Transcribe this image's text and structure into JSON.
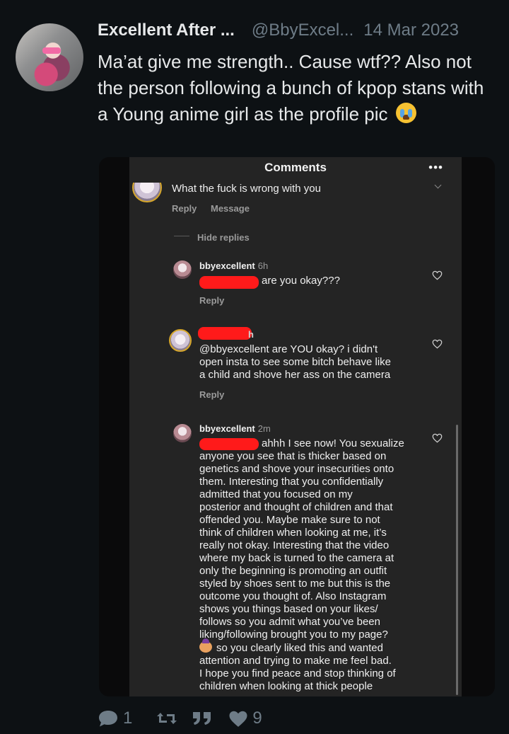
{
  "tweet": {
    "display_name": "Excellent After ...",
    "handle": "@BbyExcel...",
    "date": "14 Mar 2023",
    "text": "Ma’at give me strength.. Cause wtf?? Also not the person following a bunch of kpop stans with a Young anime girl as the profile pic",
    "emoji_icon": "loudly-crying-face"
  },
  "screenshot": {
    "title": "Comments",
    "more_glyph": "•••",
    "top_comment": {
      "text": "What the fuck is wrong with you",
      "reply_label": "Reply",
      "message_label": "Message"
    },
    "hide_replies_label": "Hide replies",
    "replies": [
      {
        "username": "bbyexcellent",
        "time": "6h",
        "text": "are you okay???",
        "reply_label": "Reply"
      },
      {
        "username": "",
        "time": "3h",
        "text_lines": [
          "@bbyexcellent are YOU okay?  i didn't",
          "open insta to see some bitch behave like",
          "a child and shove her ass on the camera"
        ],
        "reply_label": "Reply"
      },
      {
        "username": "bbyexcellent",
        "time": "2m",
        "text_lines": [
          "ahhh I see now! You sexualize",
          "anyone you see that is thicker based on",
          "genetics and shove your insecurities onto",
          "them. Interesting that you confidentially",
          "admitted that you focused on my",
          "posterior and thought of children and that",
          "offended you. Maybe make sure to not",
          "think of children when looking at me, it’s",
          "really not okay. Interesting that the video",
          "where my back is turned to the camera at",
          "only the beginning is promoting an outfit",
          "styled by shoes sent to me but this is the",
          "outcome you thought of. Also Instagram",
          "shows you things based on your likes/",
          "follows so you admit what you’ve been",
          "liking/following brought you to my page?",
          "so you clearly liked this and wanted",
          "attention and trying to make me feel bad.",
          "I hope you find peace and stop thinking of",
          "children when looking at thick people"
        ]
      }
    ]
  },
  "actions": {
    "replies_count": "1",
    "likes_count": "9"
  },
  "colors": {
    "background": "#0d1114",
    "muted": "#6e7c87",
    "redaction": "#ff1a1a"
  }
}
